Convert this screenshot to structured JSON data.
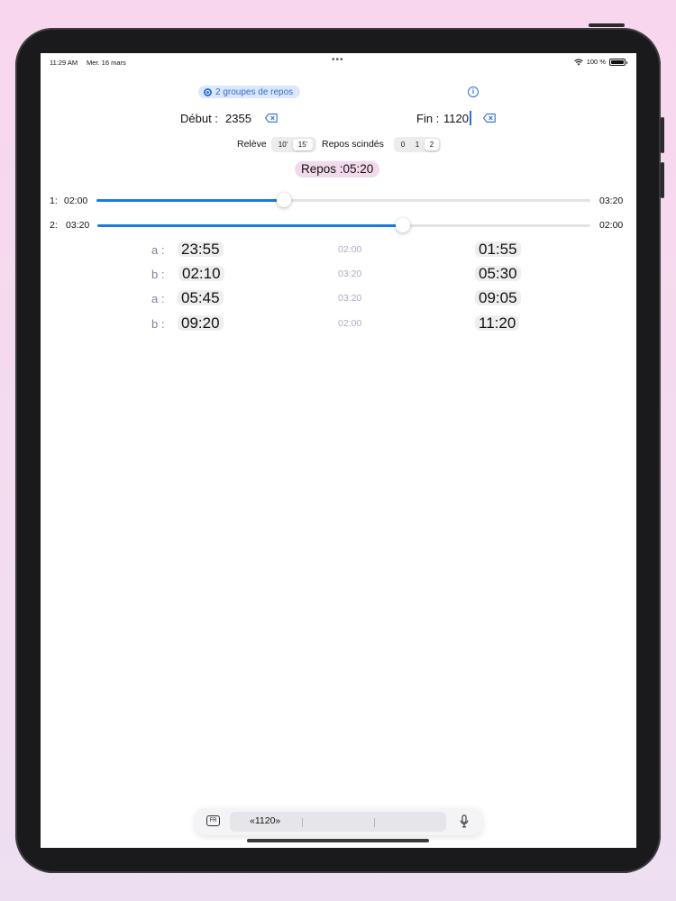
{
  "status_bar": {
    "time": "11:29 AM",
    "date": "Mer. 16 mars",
    "dots": "•••",
    "battery": "100 %"
  },
  "header": {
    "groups_label": "2 groupes de repos",
    "debut_label": "Début :",
    "debut_value": "2355",
    "fin_label": "Fin :",
    "fin_value": "1120"
  },
  "options": {
    "releve_label": "Relève",
    "releve_options": [
      "10'",
      "15'"
    ],
    "releve_selected": "15'",
    "scindes_label": "Repos scindés",
    "scindes_options": [
      "0",
      "1",
      "2"
    ],
    "scindes_selected": "2"
  },
  "repos_total": "Repos :05:20",
  "sliders": [
    {
      "index": "1:",
      "left": "02:00",
      "right": "03:20",
      "level": 0.38
    },
    {
      "index": "2:",
      "left": "03:20",
      "right": "02:00",
      "level": 0.62
    }
  ],
  "rows": [
    {
      "label": "a :",
      "start": "23:55",
      "duration": "02:00",
      "end": "01:55"
    },
    {
      "label": "b :",
      "start": "02:10",
      "duration": "03:20",
      "end": "05:30"
    },
    {
      "label": "a :",
      "start": "05:45",
      "duration": "03:20",
      "end": "09:05"
    },
    {
      "label": "b :",
      "start": "09:20",
      "duration": "02:00",
      "end": "11:20"
    }
  ],
  "keyboard_bar": {
    "language": "FR",
    "suggestion": "«1120»"
  },
  "colors": {
    "accent": "#1f7ae0",
    "pill_blue": "#dbe8fb",
    "pill_pink": "#f2d9ec",
    "label_muted": "#7c83a3"
  }
}
